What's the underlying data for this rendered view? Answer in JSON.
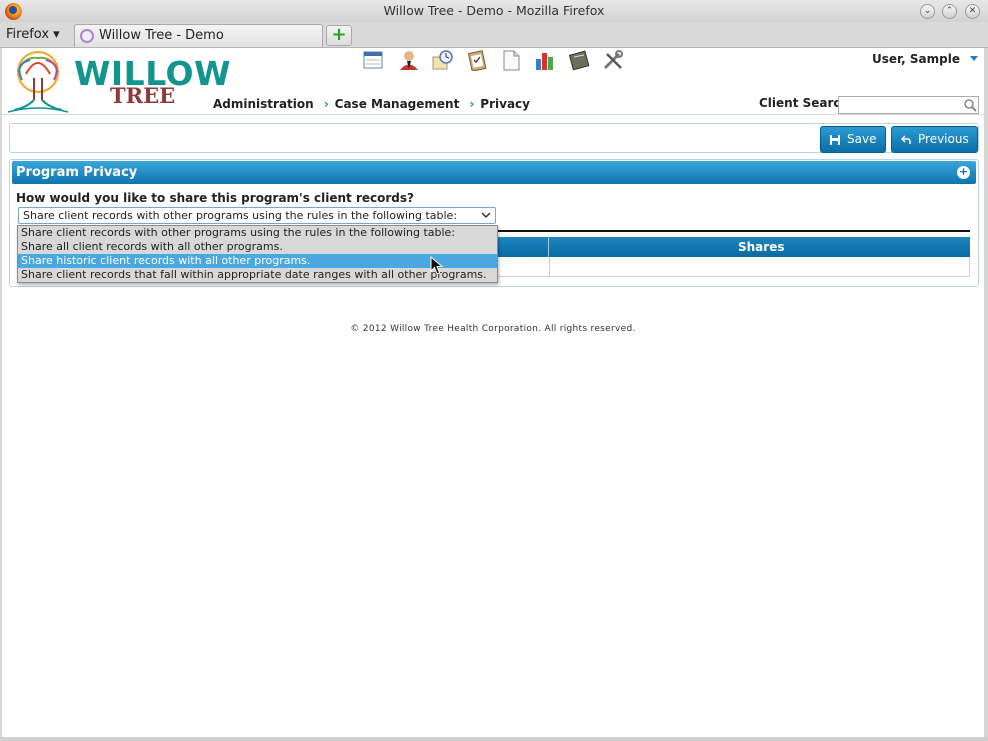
{
  "window": {
    "title": "Willow Tree - Demo - Mozilla Firefox",
    "min_glyph": "⌄",
    "max_glyph": "⌃",
    "close_glyph": "✕"
  },
  "browser": {
    "menu_label": "Firefox ▾",
    "tab_title": "Willow Tree - Demo",
    "new_tab_glyph": "+"
  },
  "header": {
    "logo_line1": "WILLOW",
    "logo_line2": "TREE",
    "user_name": "User, Sample",
    "breadcrumb": [
      "Administration",
      "Case Management",
      "Privacy"
    ],
    "crumb_sep": "›",
    "client_search_label": "Client Search",
    "toolbar_icons": [
      "calendar-icon",
      "client-icon",
      "schedule-icon",
      "clipboard-icon",
      "document-icon",
      "reports-icon",
      "notebook-icon",
      "tools-icon"
    ]
  },
  "actions": {
    "save_label": "Save",
    "previous_label": "Previous"
  },
  "panel": {
    "title": "Program Privacy",
    "toggle_glyph": "+",
    "question": "How would you like to share this program's client records?",
    "selected_value": "Share client records with other programs using the rules in the following table:",
    "options": [
      "Share client records with other programs using the rules in the following table:",
      "Share all client records with all other programs.",
      "Share historic client records with all other programs.",
      "Share client records that fall within appropriate date ranges with all other programs."
    ],
    "highlighted_option_index": 2,
    "table_columns": [
      "",
      "Shares"
    ]
  },
  "footer": "© 2012 Willow Tree Health Corporation. All rights reserved.",
  "colors": {
    "brand_teal": "#12948f",
    "brand_maroon": "#8e3a3a",
    "accent_blue": "#0f74ad",
    "highlight": "#4aa7e0"
  }
}
